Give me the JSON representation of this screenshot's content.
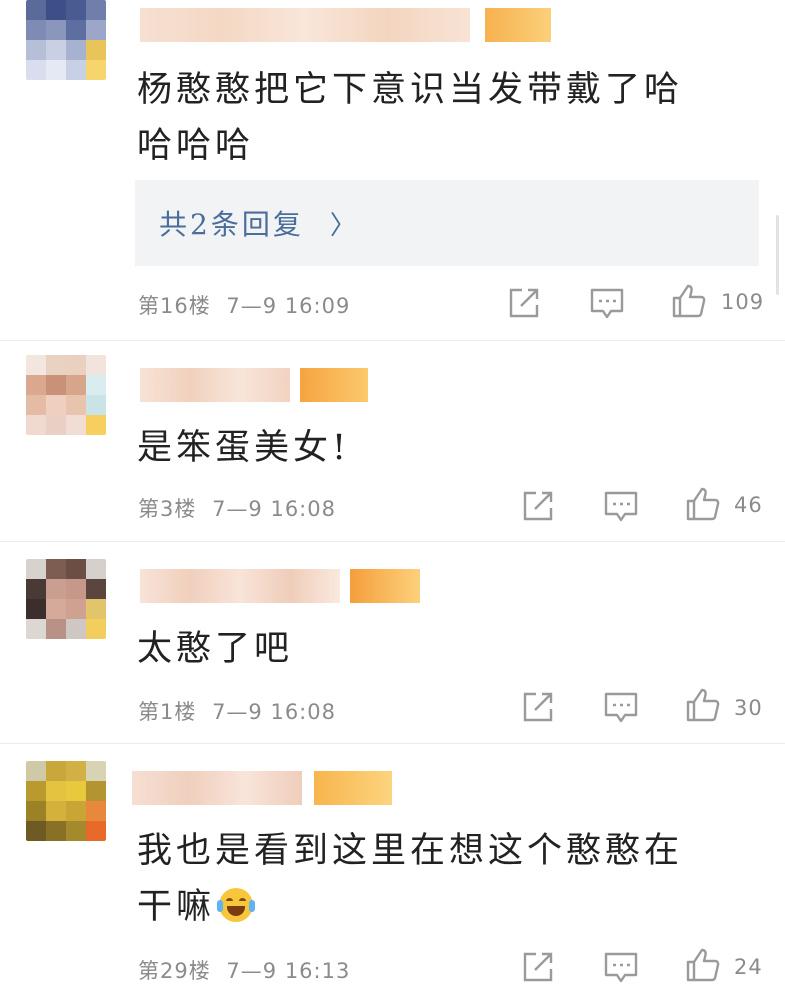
{
  "comments": [
    {
      "text": "杨憨憨把它下意识当发带戴了哈哈哈哈",
      "line1": "杨憨憨把它下意识当发带戴了哈",
      "line2": "哈哈哈",
      "replies_label": "共2条回复",
      "floor": "第16楼",
      "time": "7—9 16:09",
      "likes": "109"
    },
    {
      "text": "是笨蛋美女!",
      "floor": "第3楼",
      "time": "7—9 16:08",
      "likes": "46"
    },
    {
      "text": "太憨了吧",
      "floor": "第1楼",
      "time": "7—9 16:08",
      "likes": "30"
    },
    {
      "text": "我也是看到这里在想这个憨憨在干嘛",
      "line1": "我也是看到这里在想这个憨憨在",
      "line2": "干嘛",
      "emoji": "laughing-tears-emoji",
      "floor": "第29楼",
      "time": "7—9 16:13",
      "likes": "24"
    }
  ],
  "icons": {
    "share": "share-icon",
    "comment": "comment-icon",
    "like": "thumbs-up-icon",
    "reply_chevron": "chevron-right-icon"
  },
  "colors": {
    "text": "#222222",
    "meta": "#8b8b8b",
    "reply_link": "#4b6d9c",
    "reply_bg": "#f2f3f5",
    "icon": "#9a9a9a"
  }
}
